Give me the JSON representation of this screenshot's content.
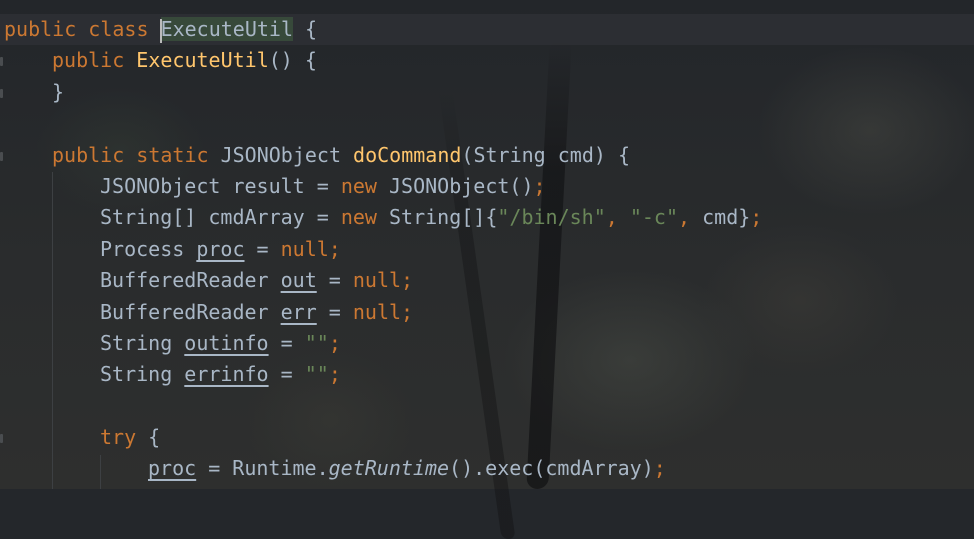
{
  "editor": {
    "language": "java",
    "colors": {
      "keyword": "#cc7832",
      "function_name": "#ffc66d",
      "string": "#6a8759",
      "default_text": "#a9b7c6",
      "background": "#24272b"
    },
    "lines": [
      {
        "indent": 0,
        "tokens": [
          {
            "t": "public",
            "c": "kw"
          },
          {
            "t": " "
          },
          {
            "t": "class",
            "c": "kw"
          },
          {
            "t": " "
          },
          {
            "t": "ExecuteUtil",
            "c": "sel-word",
            "caret": true
          },
          {
            "t": " {"
          }
        ]
      },
      {
        "indent": 1,
        "tokens": [
          {
            "t": "public",
            "c": "kw"
          },
          {
            "t": " "
          },
          {
            "t": "ExecuteUtil",
            "c": "fn"
          },
          {
            "t": "() {"
          }
        ]
      },
      {
        "indent": 1,
        "tokens": [
          {
            "t": "}"
          }
        ]
      },
      {
        "indent": 0,
        "tokens": []
      },
      {
        "indent": 1,
        "tokens": [
          {
            "t": "public",
            "c": "kw"
          },
          {
            "t": " "
          },
          {
            "t": "static",
            "c": "kw"
          },
          {
            "t": " JSONObject "
          },
          {
            "t": "doCommand",
            "c": "fn"
          },
          {
            "t": "(String cmd) {"
          }
        ]
      },
      {
        "indent": 2,
        "tokens": [
          {
            "t": "JSONObject result = "
          },
          {
            "t": "new",
            "c": "kw"
          },
          {
            "t": " JSONObject()"
          },
          {
            "t": ";",
            "c": "kw"
          }
        ]
      },
      {
        "indent": 2,
        "tokens": [
          {
            "t": "String[] cmdArray = "
          },
          {
            "t": "new",
            "c": "kw"
          },
          {
            "t": " String[]{"
          },
          {
            "t": "\"/bin/sh\"",
            "c": "str"
          },
          {
            "t": ", ",
            "c": "kw"
          },
          {
            "t": "\"-c\"",
            "c": "str"
          },
          {
            "t": ", ",
            "c": "kw"
          },
          {
            "t": "cmd}"
          },
          {
            "t": ";",
            "c": "kw"
          }
        ]
      },
      {
        "indent": 2,
        "tokens": [
          {
            "t": "Process "
          },
          {
            "t": "proc",
            "c": "ul"
          },
          {
            "t": " = "
          },
          {
            "t": "null",
            "c": "kw"
          },
          {
            "t": ";",
            "c": "kw"
          }
        ]
      },
      {
        "indent": 2,
        "tokens": [
          {
            "t": "BufferedReader "
          },
          {
            "t": "out",
            "c": "ul"
          },
          {
            "t": " = "
          },
          {
            "t": "null",
            "c": "kw"
          },
          {
            "t": ";",
            "c": "kw"
          }
        ]
      },
      {
        "indent": 2,
        "tokens": [
          {
            "t": "BufferedReader "
          },
          {
            "t": "err",
            "c": "ul"
          },
          {
            "t": " = "
          },
          {
            "t": "null",
            "c": "kw"
          },
          {
            "t": ";",
            "c": "kw"
          }
        ]
      },
      {
        "indent": 2,
        "tokens": [
          {
            "t": "String "
          },
          {
            "t": "outinfo",
            "c": "ul"
          },
          {
            "t": " = "
          },
          {
            "t": "\"\"",
            "c": "str"
          },
          {
            "t": ";",
            "c": "kw"
          }
        ]
      },
      {
        "indent": 2,
        "tokens": [
          {
            "t": "String "
          },
          {
            "t": "errinfo",
            "c": "ul"
          },
          {
            "t": " = "
          },
          {
            "t": "\"\"",
            "c": "str"
          },
          {
            "t": ";",
            "c": "kw"
          }
        ]
      },
      {
        "indent": 0,
        "tokens": []
      },
      {
        "indent": 2,
        "tokens": [
          {
            "t": "try",
            "c": "kw"
          },
          {
            "t": " {"
          }
        ]
      },
      {
        "indent": 3,
        "tokens": [
          {
            "t": "proc",
            "c": "ul"
          },
          {
            "t": " = Runtime."
          },
          {
            "t": "getRuntime",
            "c": "it"
          },
          {
            "t": "().exec(cmdArray)"
          },
          {
            "t": ";",
            "c": "kw"
          }
        ]
      }
    ]
  }
}
